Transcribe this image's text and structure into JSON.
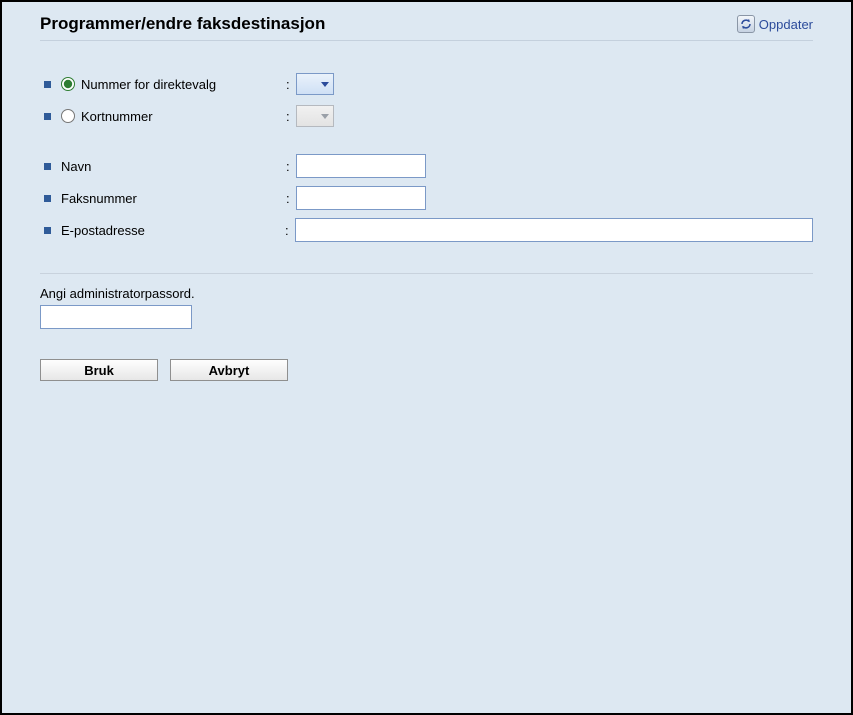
{
  "header": {
    "title": "Programmer/endre faksdestinasjon",
    "refresh_label": "Oppdater"
  },
  "form": {
    "direct_dial": {
      "label": "Nummer for direktevalg",
      "selected": true,
      "value": ""
    },
    "short_number": {
      "label": "Kortnummer",
      "selected": false,
      "value": ""
    },
    "name": {
      "label": "Navn",
      "value": ""
    },
    "fax": {
      "label": "Faksnummer",
      "value": ""
    },
    "email": {
      "label": "E-postadresse",
      "value": ""
    }
  },
  "admin": {
    "prompt": "Angi administratorpassord.",
    "value": ""
  },
  "buttons": {
    "apply": "Bruk",
    "cancel": "Avbryt"
  },
  "colon": ":"
}
